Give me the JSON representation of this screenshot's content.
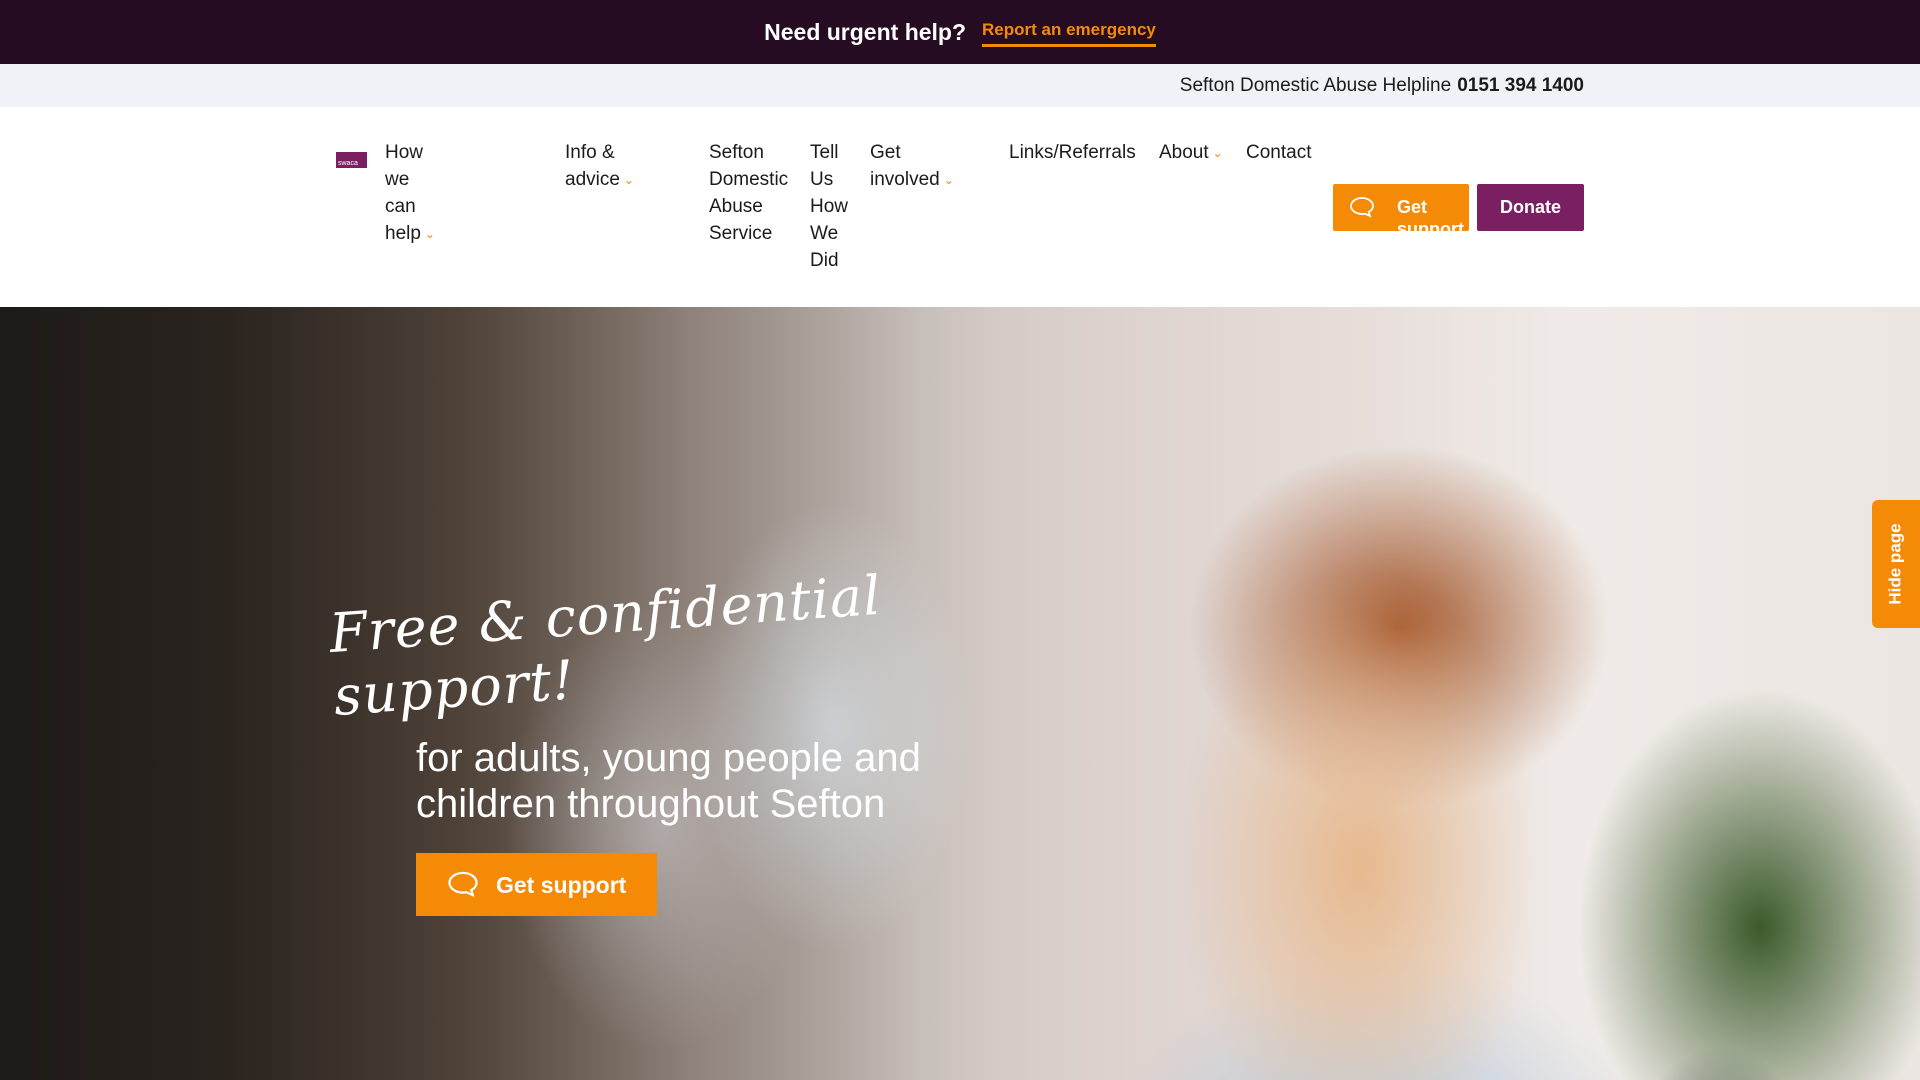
{
  "urgent": {
    "question": "Need urgent help?",
    "link": "Report an emergency"
  },
  "helpline": {
    "label": "Sefton Domestic Abuse Helpline",
    "number": "0151 394 1400"
  },
  "logo": {
    "text": "swaca"
  },
  "nav": {
    "items": [
      {
        "label": "How we can help",
        "has_dropdown": true
      },
      {
        "label": "Info & advice",
        "has_dropdown": true
      },
      {
        "label": "Sefton Domestic Abuse Service",
        "has_dropdown": false
      },
      {
        "label": "Tell Us How We Did",
        "has_dropdown": false
      },
      {
        "label": "Get involved",
        "has_dropdown": true
      },
      {
        "label": "Links/Referrals",
        "has_dropdown": false
      },
      {
        "label": "About",
        "has_dropdown": true
      },
      {
        "label": "Contact",
        "has_dropdown": false
      }
    ]
  },
  "header_buttons": {
    "get_support": "Get support",
    "donate": "Donate"
  },
  "hero": {
    "headline": "Free & confidential support!",
    "subheading": "for adults, young people and children throughout Sefton",
    "cta": "Get support"
  },
  "hide_page": "Hide page",
  "colors": {
    "urgent_bg": "#250c23",
    "accent_orange": "#f58a07",
    "brand_purple": "#7a1f61",
    "helpline_bg": "#eff3f7"
  }
}
